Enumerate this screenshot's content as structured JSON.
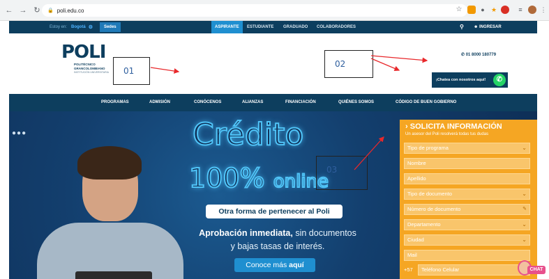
{
  "browser": {
    "url": "poli.edu.co"
  },
  "topnav": {
    "location_label": "Estoy en:",
    "city": "Bogotá",
    "sedes": "Sedes",
    "tabs": [
      "ASPIRANTE",
      "ESTUDIANTE",
      "GRADUADO",
      "COLABORADORES"
    ],
    "active_tab": "ASPIRANTE",
    "login": "INGRESAR"
  },
  "logo": {
    "text": "POLI",
    "line1": "POLITÉCNICO",
    "line2": "GRANCOLOMBIANO",
    "line3": "INSTITUCIÓN UNIVERSITARIA"
  },
  "header": {
    "phone": "01 8000 180779",
    "chat_button": "¡Chatea con nosotros aquí!"
  },
  "annotations": [
    "01",
    "02",
    "03"
  ],
  "menu": [
    "PROGRAMAS",
    "ADMISIÓN",
    "CONÓCENOS",
    "ALIANZAS",
    "FINANCIACIÓN",
    "QUIÉNES SOMOS",
    "CÓDIGO DE BUEN GOBIERNO"
  ],
  "hero": {
    "title": "Crédito",
    "online_big": "100%",
    "online_small": "online",
    "tagline": "Otra forma de pertenecer al Poli",
    "aprob_bold": "Aprobación inmediata,",
    "aprob_rest1": " sin documentos",
    "aprob_line2": "y bajas tasas de interés.",
    "cta_text": "Conoce más ",
    "cta_bold": "aquí"
  },
  "form": {
    "title": "SOLICITA INFORMACIÓN",
    "subtitle": "Un asesor del Poli resolverá todas tus dudas",
    "fields": [
      "Tipo de programa",
      "Nombre",
      "Apellido",
      "Tipo de documento",
      "Número de documento",
      "Departamento",
      "Ciudad",
      "Mail",
      "Teléfono Celular"
    ],
    "phone_prefix": "+57"
  },
  "chat_badge": "CHAT",
  "colors": {
    "navy": "#0d3e5e",
    "accent_blue": "#1f8fd0",
    "form_orange": "#f5a623",
    "annotation_arrow": "#e8282b"
  }
}
